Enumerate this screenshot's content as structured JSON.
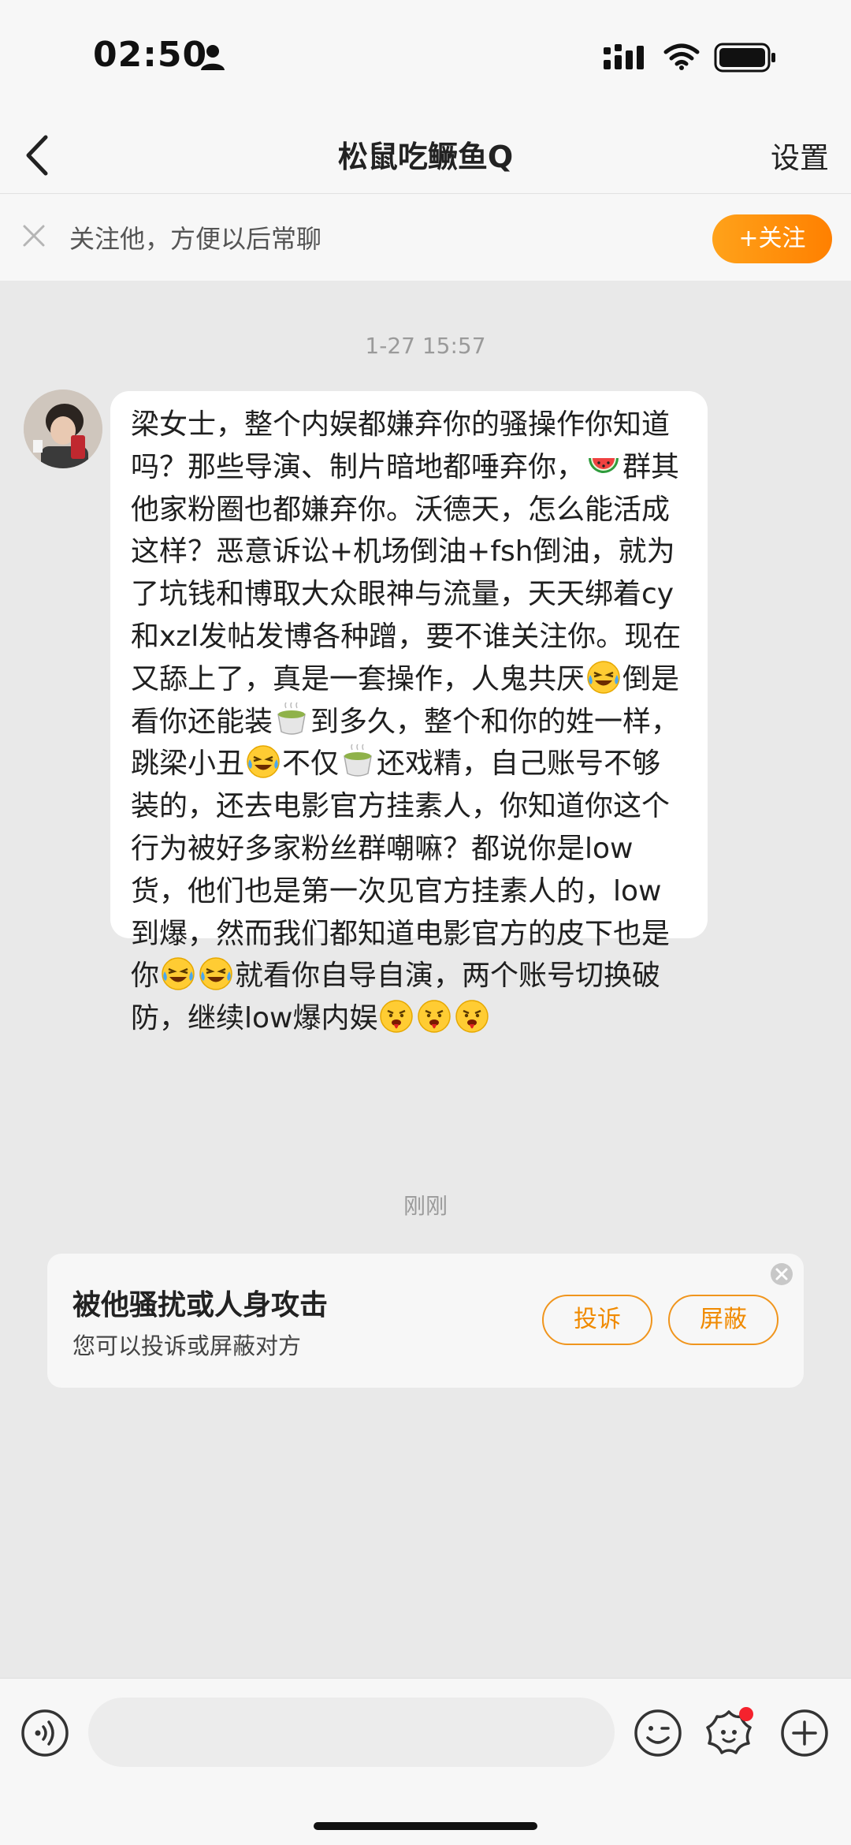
{
  "status_bar": {
    "time": "02:50"
  },
  "nav": {
    "title": "松鼠吃鳜鱼Q",
    "settings_label": "设置"
  },
  "follow_bar": {
    "prompt": "关注他，方便以后常聊",
    "follow_label": "+关注"
  },
  "chat": {
    "timestamp_1": "1-27 15:57",
    "message": {
      "part_1": "梁女士，整个内娱都嫌弃你的骚操作你知道吗？那些导演、制片暗地都唾弃你，",
      "part_2": "群其他家粉圈也都嫌弃你。沃德天，怎么能活成这样？恶意诉讼+机场倒油+fsh倒油，就为了坑钱和博取大众眼神与流量，天天绑着cy和xzl发帖发博各种蹭，要不谁关注你。现在又舔上了，真是一套操作，人鬼共厌",
      "part_3": "倒是看你还能装",
      "part_4": "到多久，整个和你的姓一样，跳梁小丑",
      "part_5": "不仅",
      "part_6": "还戏精，自己账号不够装的，还去电影官方挂素人，你知道你这个行为被好多家粉丝群嘲嘛？都说你是low货，他们也是第一次见官方挂素人的，low到爆，然而我们都知道电影官方的皮下也是你",
      "part_7": "就看你自导自演，两个账号切换破防，继续low爆内娱",
      "emojis": [
        "watermelon-emoji",
        "crying-laughing-emoji",
        "tea-emoji",
        "spitting-blood-emoji"
      ]
    },
    "timestamp_2": "刚刚",
    "harass_card": {
      "title": "被他骚扰或人身攻击",
      "subtitle": "您可以投诉或屏蔽对方",
      "report_label": "投诉",
      "block_label": "屏蔽"
    }
  },
  "input_bar": {
    "placeholder": "",
    "sticker_badge_color": "#f5222d"
  },
  "colors": {
    "accent": "#ff8a00",
    "background": "#e9e9e9"
  }
}
